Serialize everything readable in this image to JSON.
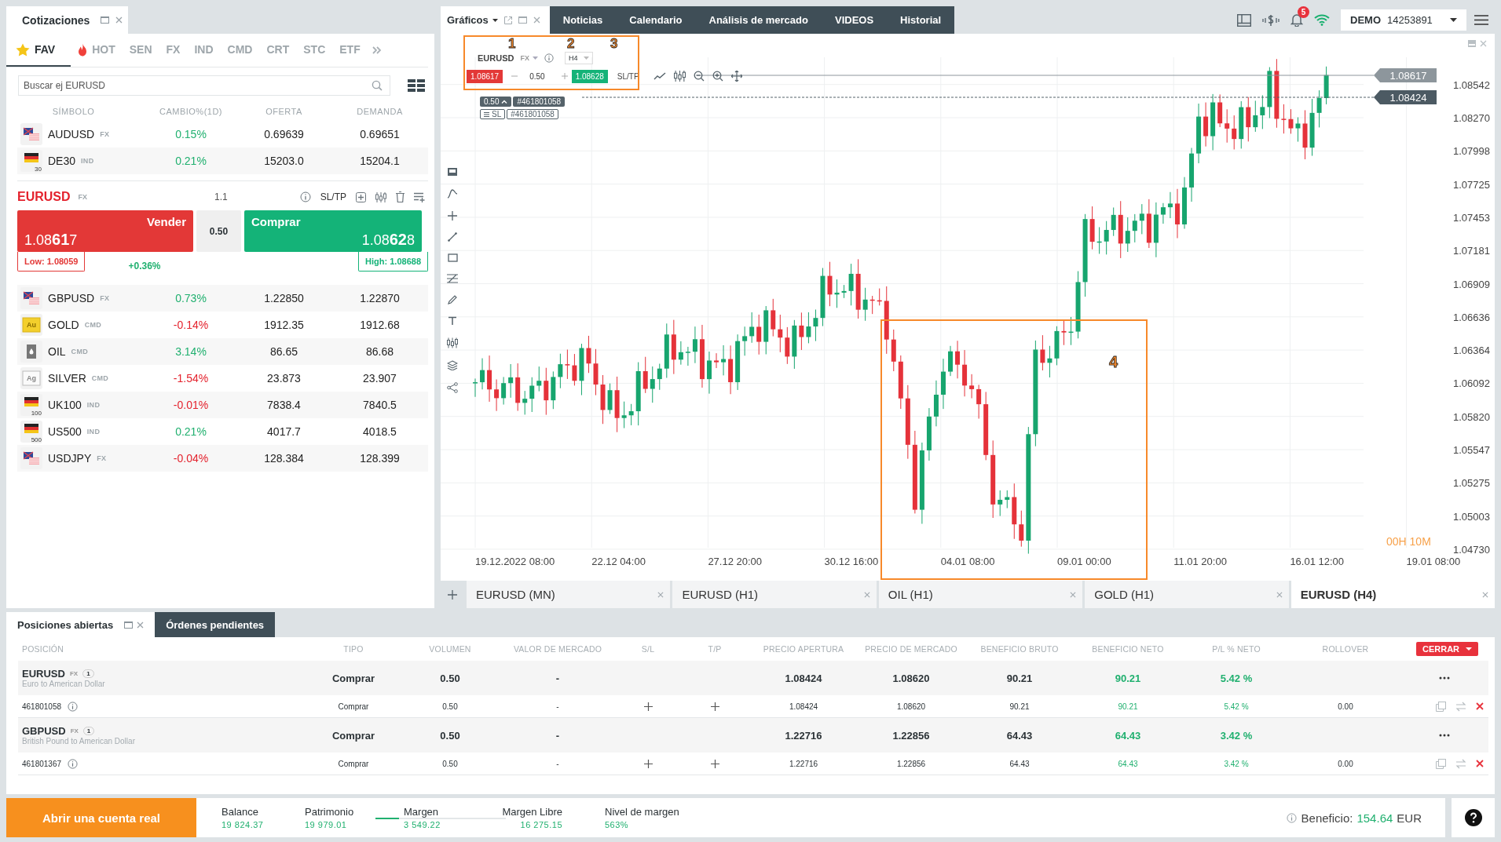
{
  "quotes_panel": {
    "title": "Cotizaciones",
    "categories": [
      {
        "label": "FAV",
        "kind": "favorites",
        "selected": true
      },
      {
        "label": "HOT",
        "kind": "hot",
        "selected": false
      },
      {
        "label": "SEN",
        "selected": false
      },
      {
        "label": "FX",
        "selected": false
      },
      {
        "label": "IND",
        "selected": false
      },
      {
        "label": "CMD",
        "selected": false
      },
      {
        "label": "CRT",
        "selected": false
      },
      {
        "label": "STC",
        "selected": false
      },
      {
        "label": "ETF",
        "selected": false
      }
    ],
    "search": {
      "placeholder": "Buscar ej EURUSD"
    },
    "columns": [
      "SÍMBOLO",
      "CAMBIO%(1D)",
      "OFERTA",
      "DEMANDA"
    ],
    "rows_top": [
      {
        "symbol": "AUDUSD",
        "type": "FX",
        "kind": "currency",
        "change": "0.15%",
        "up": true,
        "bid": "0.69639",
        "ask": "0.69651"
      },
      {
        "symbol": "DE30",
        "type": "IND",
        "kind": "index",
        "icon_label": "30",
        "change": "0.21%",
        "up": true,
        "bid": "15203.0",
        "ask": "15204.1"
      }
    ],
    "trade": {
      "symbol": "EURUSD",
      "type": "FX",
      "leverage": "1.1",
      "sltp": "SL/TP",
      "sell_label": "Vender",
      "sell_price": "1.08**61**7",
      "volume": "0.50",
      "buy_label": "Comprar",
      "buy_price": "1.08**62**8",
      "low": "Low: 1.08059",
      "change": "+0.36%",
      "high": "High: 1.08688"
    },
    "rows": [
      {
        "symbol": "GBPUSD",
        "type": "FX",
        "kind": "currency",
        "change": "0.73%",
        "up": true,
        "bid": "1.22850",
        "ask": "1.22870"
      },
      {
        "symbol": "GOLD",
        "type": "CMD",
        "kind": "gold",
        "icon_label": "Au",
        "change": "-0.14%",
        "up": false,
        "bid": "1912.35",
        "ask": "1912.68"
      },
      {
        "symbol": "OIL",
        "type": "CMD",
        "kind": "oil",
        "change": "3.14%",
        "up": true,
        "bid": "86.65",
        "ask": "86.68"
      },
      {
        "symbol": "SILVER",
        "type": "CMD",
        "kind": "silver",
        "icon_label": "Ag",
        "change": "-1.54%",
        "up": false,
        "bid": "23.873",
        "ask": "23.907"
      },
      {
        "symbol": "UK100",
        "type": "IND",
        "kind": "index",
        "icon_label": "100",
        "change": "-0.01%",
        "up": false,
        "bid": "7838.4",
        "ask": "7840.5"
      },
      {
        "symbol": "US500",
        "type": "IND",
        "kind": "index",
        "icon_label": "500",
        "change": "0.21%",
        "up": true,
        "bid": "4017.7",
        "ask": "4018.5"
      },
      {
        "symbol": "USDJPY",
        "type": "FX",
        "kind": "currency",
        "change": "-0.04%",
        "up": false,
        "bid": "128.384",
        "ask": "128.399"
      }
    ]
  },
  "top_tabs": [
    {
      "label": "Gráficos",
      "selected": true
    },
    {
      "label": "Noticias",
      "selected": false
    },
    {
      "label": "Calendario",
      "selected": false
    },
    {
      "label": "Análisis de mercado",
      "selected": false
    },
    {
      "label": "VIDEOS",
      "selected": false
    },
    {
      "label": "Historial",
      "selected": false
    }
  ],
  "top_bar": {
    "notifications": "5",
    "account_mode": "DEMO",
    "account_number": "14253891"
  },
  "chart": {
    "symbol": "EURUSD",
    "type": "FX",
    "timeframe": "H4",
    "sell": "1.08617",
    "volume": "0.50",
    "buy": "1.08628",
    "sltp": "SL/TP",
    "position_volume": "0.50",
    "position_order": "#461801058",
    "sl_label": "SL",
    "sl_order": "#461801058",
    "price_axis": [
      "1.08542",
      "1.08270",
      "1.07998",
      "1.07725",
      "1.07453",
      "1.07181",
      "1.06909",
      "1.06636",
      "1.06364",
      "1.06092",
      "1.05820",
      "1.05547",
      "1.05275",
      "1.05003",
      "1.04730"
    ],
    "price_tags": [
      {
        "price": "1.08617",
        "kind": "bid"
      },
      {
        "price": "1.08424",
        "kind": "position"
      }
    ],
    "time_axis": [
      "19.12.2022 08:00",
      "22.12 04:00",
      "27.12 20:00",
      "30.12 16:00",
      "04.01 08:00",
      "09.01 00:00",
      "11.01 20:00",
      "16.01 12:00",
      "19.01 08:00"
    ],
    "countdown": "00H 10M",
    "annotations": [
      "1",
      "2",
      "3",
      "4"
    ],
    "tabs": [
      {
        "label": "EURUSD (MN)",
        "selected": false
      },
      {
        "label": "EURUSD (H1)",
        "selected": false
      },
      {
        "label": "OIL (H1)",
        "selected": false
      },
      {
        "label": "GOLD (H1)",
        "selected": false
      },
      {
        "label": "EURUSD (H4)",
        "selected": true
      }
    ]
  },
  "positions_panel": {
    "tabs": [
      {
        "label": "Posiciones abiertas",
        "selected": true
      },
      {
        "label": "Órdenes pendientes",
        "selected": false
      }
    ],
    "columns": [
      "POSICIÓN",
      "TIPO",
      "VOLUMEN",
      "VALOR DE MERCADO",
      "S/L",
      "T/P",
      "PRECIO APERTURA",
      "PRECIO DE MERCADO",
      "BENEFICIO BRUTO",
      "BENEFICIO NETO",
      "P/L % NETO",
      "ROLLOVER"
    ],
    "close_button": "CERRAR",
    "groups": [
      {
        "symbol": "EURUSD",
        "type": "FX",
        "count": "1",
        "description": "Euro to American Dollar",
        "side": "Comprar",
        "volume": "0.50",
        "market_value": "-",
        "open": "1.08424",
        "market": "1.08620",
        "gross": "90.21",
        "net": "90.21",
        "pl": "5.42 %",
        "trade": {
          "id": "461801058",
          "side": "Comprar",
          "volume": "0.50",
          "market_value": "-",
          "open": "1.08424",
          "market": "1.08620",
          "gross": "90.21",
          "net": "90.21",
          "pl": "5.42 %",
          "rollover": "0.00"
        }
      },
      {
        "symbol": "GBPUSD",
        "type": "FX",
        "count": "1",
        "description": "British Pound to American Dollar",
        "side": "Comprar",
        "volume": "0.50",
        "market_value": "-",
        "open": "1.22716",
        "market": "1.22856",
        "gross": "64.43",
        "net": "64.43",
        "pl": "3.42 %",
        "trade": {
          "id": "461801367",
          "side": "Comprar",
          "volume": "0.50",
          "market_value": "-",
          "open": "1.22716",
          "market": "1.22856",
          "gross": "64.43",
          "net": "64.43",
          "pl": "3.42 %",
          "rollover": "0.00"
        }
      }
    ]
  },
  "footer": {
    "open_account": "Abrir una cuenta real",
    "stats": [
      {
        "label": "Balance",
        "value": "19 824.37"
      },
      {
        "label": "Patrimonio",
        "value": "19 979.01"
      },
      {
        "label": "Margen",
        "value": "3 549.22"
      },
      {
        "label": "Margen Libre",
        "value": "16 275.15"
      },
      {
        "label": "Nivel de margen",
        "value": "563%"
      }
    ],
    "margin_bar": {
      "level": 0.18
    },
    "profit_label": "Beneficio:",
    "profit_value": "154.64",
    "profit_currency": "EUR"
  }
}
